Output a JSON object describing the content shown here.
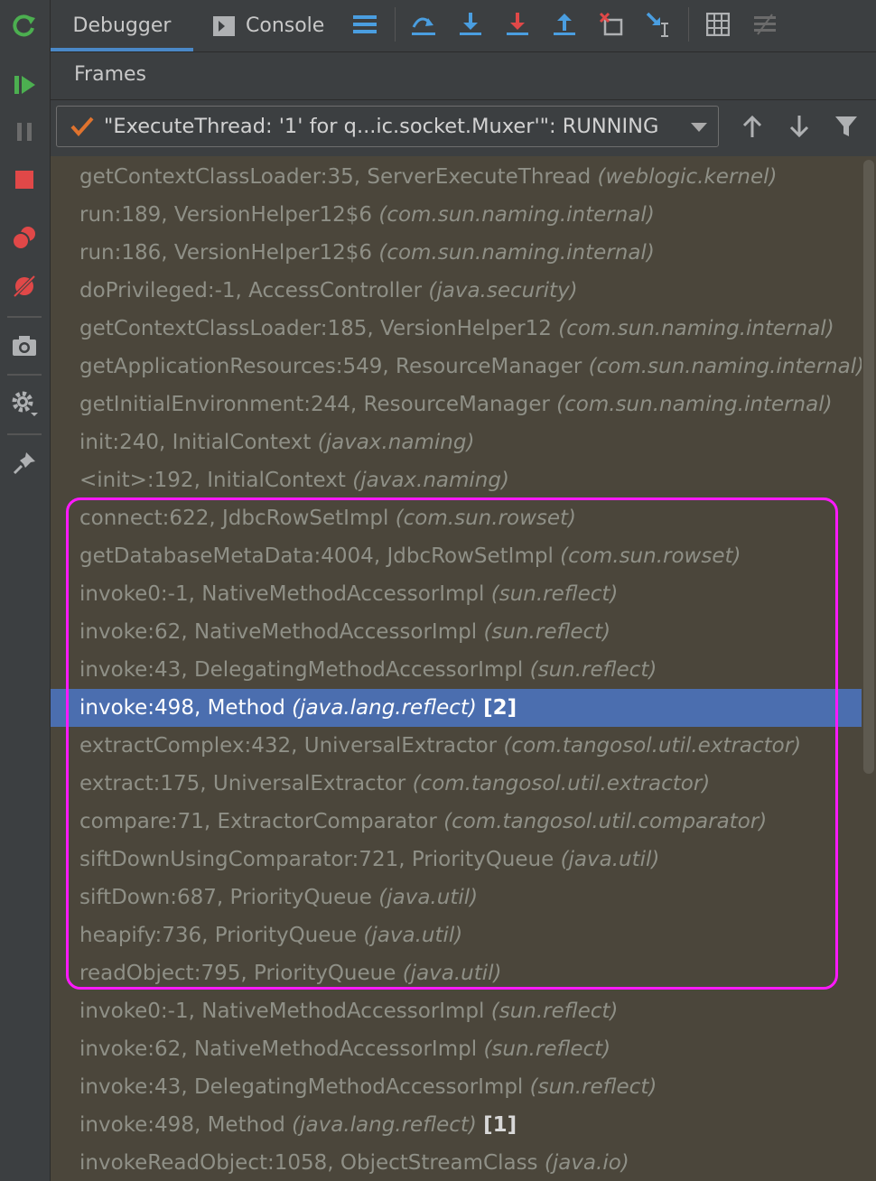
{
  "tabs": {
    "debugger": "Debugger",
    "console": "Console"
  },
  "frames": {
    "title": "Frames",
    "thread": "\"ExecuteThread: '1' for q...ic.socket.Muxer'\": RUNNING",
    "items": [
      {
        "method": "getContextClassLoader:35, ServerExecuteThread",
        "pkg": "(weblogic.kernel)",
        "count": ""
      },
      {
        "method": "run:189, VersionHelper12$6",
        "pkg": "(com.sun.naming.internal)",
        "count": ""
      },
      {
        "method": "run:186, VersionHelper12$6",
        "pkg": "(com.sun.naming.internal)",
        "count": ""
      },
      {
        "method": "doPrivileged:-1, AccessController",
        "pkg": "(java.security)",
        "count": ""
      },
      {
        "method": "getContextClassLoader:185, VersionHelper12",
        "pkg": "(com.sun.naming.internal)",
        "count": ""
      },
      {
        "method": "getApplicationResources:549, ResourceManager",
        "pkg": "(com.sun.naming.internal)",
        "count": ""
      },
      {
        "method": "getInitialEnvironment:244, ResourceManager",
        "pkg": "(com.sun.naming.internal)",
        "count": ""
      },
      {
        "method": "init:240, InitialContext",
        "pkg": "(javax.naming)",
        "count": ""
      },
      {
        "method": "<init>:192, InitialContext",
        "pkg": "(javax.naming)",
        "count": ""
      },
      {
        "method": "connect:622, JdbcRowSetImpl",
        "pkg": "(com.sun.rowset)",
        "count": ""
      },
      {
        "method": "getDatabaseMetaData:4004, JdbcRowSetImpl",
        "pkg": "(com.sun.rowset)",
        "count": ""
      },
      {
        "method": "invoke0:-1, NativeMethodAccessorImpl",
        "pkg": "(sun.reflect)",
        "count": ""
      },
      {
        "method": "invoke:62, NativeMethodAccessorImpl",
        "pkg": "(sun.reflect)",
        "count": ""
      },
      {
        "method": "invoke:43, DelegatingMethodAccessorImpl",
        "pkg": "(sun.reflect)",
        "count": ""
      },
      {
        "method": "invoke:498, Method",
        "pkg": "(java.lang.reflect)",
        "count": "[2]"
      },
      {
        "method": "extractComplex:432, UniversalExtractor",
        "pkg": "(com.tangosol.util.extractor)",
        "count": ""
      },
      {
        "method": "extract:175, UniversalExtractor",
        "pkg": "(com.tangosol.util.extractor)",
        "count": ""
      },
      {
        "method": "compare:71, ExtractorComparator",
        "pkg": "(com.tangosol.util.comparator)",
        "count": ""
      },
      {
        "method": "siftDownUsingComparator:721, PriorityQueue",
        "pkg": "(java.util)",
        "count": ""
      },
      {
        "method": "siftDown:687, PriorityQueue",
        "pkg": "(java.util)",
        "count": ""
      },
      {
        "method": "heapify:736, PriorityQueue",
        "pkg": "(java.util)",
        "count": ""
      },
      {
        "method": "readObject:795, PriorityQueue",
        "pkg": "(java.util)",
        "count": ""
      },
      {
        "method": "invoke0:-1, NativeMethodAccessorImpl",
        "pkg": "(sun.reflect)",
        "count": ""
      },
      {
        "method": "invoke:62, NativeMethodAccessorImpl",
        "pkg": "(sun.reflect)",
        "count": ""
      },
      {
        "method": "invoke:43, DelegatingMethodAccessorImpl",
        "pkg": "(sun.reflect)",
        "count": ""
      },
      {
        "method": "invoke:498, Method",
        "pkg": "(java.lang.reflect)",
        "count": "[1]"
      },
      {
        "method": "invokeReadObject:1058, ObjectStreamClass",
        "pkg": "(java.io)",
        "count": ""
      }
    ],
    "selected_index": 14
  },
  "colors": {
    "selection": "#4b6eaf",
    "annotation_box": "#ff19ff",
    "frame_text": "#8f9087",
    "list_background": "#4b463b"
  },
  "icons": {
    "left_toolbar": [
      "rerun-icon",
      "resume-icon",
      "pause-icon",
      "stop-icon",
      "view-breakpoints-icon",
      "mute-breakpoints-icon",
      "camera-icon",
      "settings-icon",
      "pin-icon"
    ],
    "top_toolbar": [
      "console-icon",
      "layout-menu-icon",
      "show-execution-point-icon",
      "step-over-icon",
      "step-into-icon",
      "force-step-into-icon",
      "step-out-icon",
      "drop-frame-icon",
      "run-to-cursor-icon",
      "evaluate-expression-icon",
      "trace-icon"
    ]
  }
}
